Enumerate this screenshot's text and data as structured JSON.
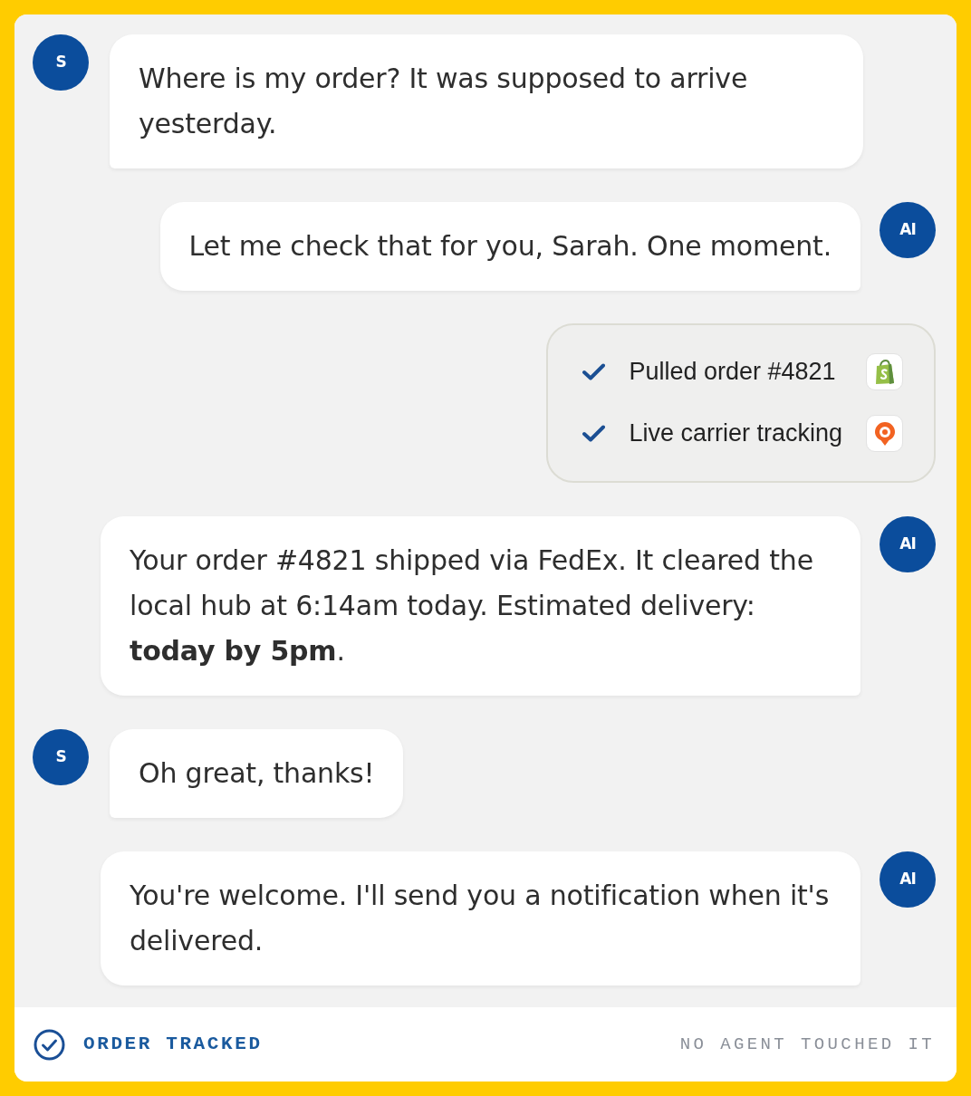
{
  "messages": [
    {
      "kind": "customer",
      "avatar": "S",
      "text": "Where is my order? It was supposed to arrive yesterday."
    },
    {
      "kind": "agent",
      "avatar": "AI",
      "text": "Let me check that for you, Sarah. One moment."
    },
    {
      "kind": "tools",
      "steps": [
        {
          "label": "Pulled order #4821",
          "checked": true
        },
        {
          "label": "Live carrier tracking",
          "checked": true
        }
      ]
    },
    {
      "kind": "agent",
      "avatar": "AI",
      "text": "Your order #4821 shipped via FedEx. It cleared the local hub at 6:14am today. Estimated delivery: **today by 5pm**."
    },
    {
      "kind": "customer",
      "avatar": "S",
      "text": "Oh great, thanks!"
    },
    {
      "kind": "agent",
      "avatar": "AI",
      "text": "You're welcome. I'll send you a notification when it's delivered."
    }
  ],
  "status_bar": {
    "status": "ORDER TRACKED",
    "note": "NO AGENT TOUCHED IT"
  }
}
